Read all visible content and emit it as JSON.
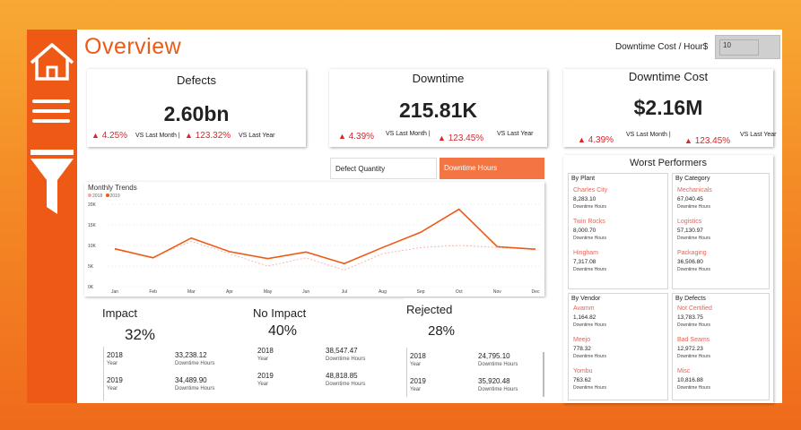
{
  "header": {
    "title": "Overview",
    "cost_label": "Downtime Cost / Hour$",
    "cost_value": "10"
  },
  "kpis": [
    {
      "title": "Defects",
      "value": "2.60bn",
      "month_change": "4.25%",
      "month_label": "VS Last Month |",
      "year_change": "123.32%",
      "year_label": "VS Last Year"
    },
    {
      "title": "Downtime",
      "value": "215.81K",
      "month_change": "4.39%",
      "month_label": "VS Last Month |",
      "year_change": "123.45%",
      "year_label": "VS Last Year"
    },
    {
      "title": "Downtime Cost",
      "value": "$2.16M",
      "month_change": "4.39%",
      "month_label": "VS Last Month |",
      "year_change": "123.45%",
      "year_label": "VS Last Year"
    }
  ],
  "toggles": {
    "defect_quantity": "Defect Quantity",
    "downtime_hours": "Downtime Hours"
  },
  "colors": {
    "accent": "#ee5a16",
    "negative": "#d8262b",
    "line_2019": "#ee5a16",
    "line_2018": "#f3a9a0"
  },
  "chart_data": {
    "type": "line",
    "title": "Monthly Trends",
    "x": [
      "Jan",
      "Feb",
      "Mar",
      "Apr",
      "May",
      "Jun",
      "Jul",
      "Aug",
      "Sep",
      "Oct",
      "Nov",
      "Dec"
    ],
    "yticks": [
      "20K",
      "15K",
      "10K",
      "5K",
      "0K"
    ],
    "ylim": [
      0,
      20000
    ],
    "grid": true,
    "legend_position": "top-left",
    "series": [
      {
        "name": "2018",
        "values": [
          9000,
          7200,
          11000,
          8000,
          5000,
          7000,
          4000,
          8000,
          9500,
          10000,
          9500,
          9000
        ]
      },
      {
        "name": "2019",
        "values": [
          9200,
          7000,
          11800,
          8500,
          6800,
          8400,
          5600,
          9500,
          13200,
          18800,
          9700,
          9100
        ]
      }
    ]
  },
  "impact_cards": [
    {
      "title": "Impact",
      "pct": "32%",
      "rows": [
        {
          "year": "2018",
          "year_label": "Year",
          "value": "33,238.12",
          "value_label": "Downtime Hours"
        },
        {
          "year": "2019",
          "year_label": "Year",
          "value": "34,489.90",
          "value_label": "Downtime Hours"
        }
      ]
    },
    {
      "title": "No Impact",
      "pct": "40%",
      "rows": [
        {
          "year": "2018",
          "year_label": "Year",
          "value": "38,547.47",
          "value_label": "Downtime Hours"
        },
        {
          "year": "2019",
          "year_label": "Year",
          "value": "48,818.85",
          "value_label": "Downtime Hours"
        }
      ]
    },
    {
      "title": "Rejected",
      "pct": "28%",
      "rows": [
        {
          "year": "2018",
          "year_label": "Year",
          "value": "24,795.10",
          "value_label": "Downtime Hours"
        },
        {
          "year": "2019",
          "year_label": "Year",
          "value": "35,920.48",
          "value_label": "Downtime Hours"
        }
      ]
    }
  ],
  "worst": {
    "title": "Worst Performers",
    "groups": [
      {
        "header": "By Plant",
        "items": [
          {
            "name": "Charles City",
            "value": "8,283.10",
            "label": "Downtime Hours"
          },
          {
            "name": "Twin Rocks",
            "value": "8,000.70",
            "label": "Downtime Hours"
          },
          {
            "name": "Hingham",
            "value": "7,317.08",
            "label": "Downtime Hours"
          }
        ]
      },
      {
        "header": "By Category",
        "items": [
          {
            "name": "Mechanicals",
            "value": "67,040.45",
            "label": "Downtime Hours"
          },
          {
            "name": "Logistics",
            "value": "57,130.97",
            "label": "Downtime Hours"
          },
          {
            "name": "Packaging",
            "value": "36,506.80",
            "label": "Downtime Hours"
          }
        ]
      },
      {
        "header": "By Vendor",
        "items": [
          {
            "name": "Avamm",
            "value": "1,164.82",
            "label": "Downtime Hours"
          },
          {
            "name": "Meejo",
            "value": "778.32",
            "label": "Downtime Hours"
          },
          {
            "name": "Yombu",
            "value": "763.62",
            "label": "Downtime Hours"
          }
        ]
      },
      {
        "header": "By Defects",
        "items": [
          {
            "name": "Not Certified",
            "value": "13,783.75",
            "label": "Downtime Hours"
          },
          {
            "name": "Bad Seams",
            "value": "12,972.23",
            "label": "Downtime Hours"
          },
          {
            "name": "Misc",
            "value": "10,816.88",
            "label": "Downtime Hours"
          }
        ]
      }
    ]
  }
}
